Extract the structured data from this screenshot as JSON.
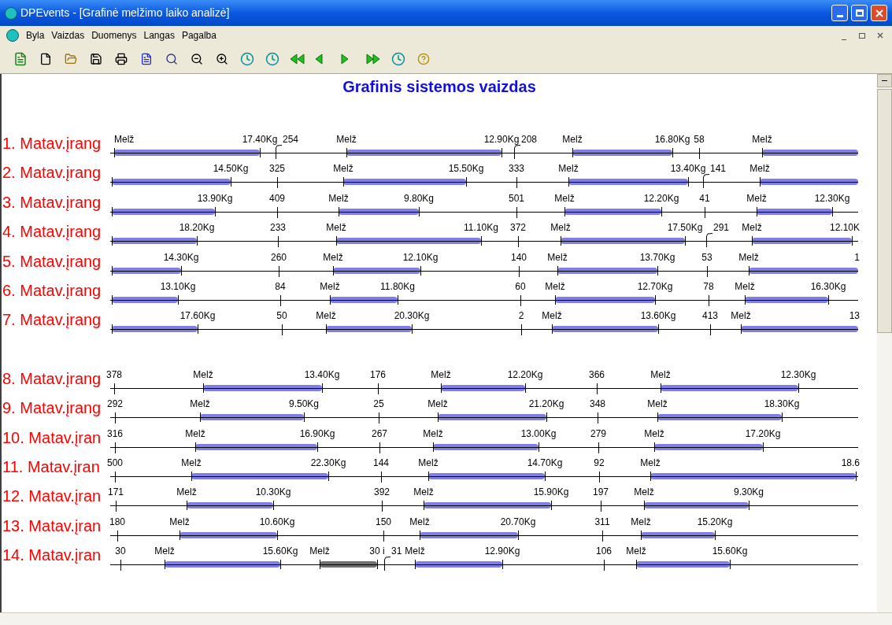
{
  "window": {
    "title": "DPEvents - [Grafinė melžimo laiko analizė]"
  },
  "menu": [
    "Byla",
    "Vaizdas",
    "Duomenys",
    "Langas",
    "Pagalba"
  ],
  "chart": {
    "title": "Grafinis sistemos vaizdas",
    "groups": [
      {
        "rows": [
          {
            "label": "1. Matav.įrang",
            "items": [
              {
                "kind": "milking",
                "start": "Melž",
                "end": "17.40Kg"
              },
              {
                "kind": "callout",
                "text": "254"
              },
              {
                "kind": "milking",
                "start": "Melž",
                "end": "12.90Kg"
              },
              {
                "kind": "callout",
                "text": "208"
              },
              {
                "kind": "milking",
                "start": "Melž",
                "end": "16.80Kg"
              },
              {
                "kind": "tick",
                "text": "58"
              },
              {
                "kind": "milking",
                "start": "Melž"
              }
            ]
          },
          {
            "label": "2. Matav.įrang",
            "items": [
              {
                "kind": "milking",
                "end": "14.50Kg"
              },
              {
                "kind": "tick",
                "text": "325"
              },
              {
                "kind": "milking",
                "start": "Melž",
                "end": "15.50Kg"
              },
              {
                "kind": "tick",
                "text": "333"
              },
              {
                "kind": "milking",
                "start": "Melž",
                "end": "13.40Kg"
              },
              {
                "kind": "callout",
                "text": "141"
              },
              {
                "kind": "milking",
                "start": "Melž"
              }
            ]
          },
          {
            "label": "3. Matav.įrang",
            "items": [
              {
                "kind": "milking",
                "end": "13.90Kg"
              },
              {
                "kind": "tick",
                "text": "409"
              },
              {
                "kind": "milking",
                "start": "Melž",
                "end": "9.80Kg"
              },
              {
                "kind": "tick",
                "text": "501"
              },
              {
                "kind": "milking",
                "start": "Melž",
                "end": "12.20Kg"
              },
              {
                "kind": "tick",
                "text": "41"
              },
              {
                "kind": "milking",
                "start": "Melž",
                "end": "12.30Kg"
              }
            ]
          },
          {
            "label": "4. Matav.įrang",
            "items": [
              {
                "kind": "milking",
                "end": "18.20Kg"
              },
              {
                "kind": "tick",
                "text": "233"
              },
              {
                "kind": "milking",
                "start": "Melž",
                "end": "11.10Kg"
              },
              {
                "kind": "tick",
                "text": "372"
              },
              {
                "kind": "milking",
                "start": "Melž",
                "end": "17.50Kg"
              },
              {
                "kind": "callout",
                "text": "291"
              },
              {
                "kind": "milking",
                "start": "Melž",
                "end": "12.10K"
              }
            ]
          },
          {
            "label": "5. Matav.įrang",
            "items": [
              {
                "kind": "milking",
                "end": "14.30Kg"
              },
              {
                "kind": "tick",
                "text": "260"
              },
              {
                "kind": "milking",
                "start": "Melž",
                "end": "12.10Kg"
              },
              {
                "kind": "tick",
                "text": "140"
              },
              {
                "kind": "milking",
                "start": "Melž",
                "end": "13.70Kg"
              },
              {
                "kind": "tick",
                "text": "53"
              },
              {
                "kind": "milking",
                "start": "Melž",
                "end": "1"
              }
            ]
          },
          {
            "label": "6. Matav.įrang",
            "items": [
              {
                "kind": "milking",
                "end": "13.10Kg"
              },
              {
                "kind": "tick",
                "text": "84"
              },
              {
                "kind": "milking",
                "start": "Melž",
                "end": "11.80Kg"
              },
              {
                "kind": "tick",
                "text": "60"
              },
              {
                "kind": "milking",
                "start": "Melž",
                "end": "12.70Kg"
              },
              {
                "kind": "tick",
                "text": "78"
              },
              {
                "kind": "milking",
                "start": "Melž",
                "end": "16.30Kg"
              }
            ]
          },
          {
            "label": "7. Matav.įrang",
            "items": [
              {
                "kind": "milking",
                "end": "17.60Kg"
              },
              {
                "kind": "tick",
                "text": "50"
              },
              {
                "kind": "milking",
                "start": "Melž",
                "end": "20.30Kg"
              },
              {
                "kind": "tick",
                "text": "2"
              },
              {
                "kind": "milking",
                "start": "Melž",
                "end": "13.60Kg"
              },
              {
                "kind": "tick",
                "text": "413"
              },
              {
                "kind": "milking",
                "start": "Melž",
                "end": "13"
              }
            ]
          }
        ]
      },
      {
        "rows": [
          {
            "label": "8. Matav.įrang",
            "items": [
              {
                "kind": "tick",
                "text": "378"
              },
              {
                "kind": "milking",
                "start": "Melž",
                "end": "13.40Kg"
              },
              {
                "kind": "tick",
                "text": "176"
              },
              {
                "kind": "milking",
                "start": "Melž",
                "end": "12.20Kg"
              },
              {
                "kind": "tick",
                "text": "366"
              },
              {
                "kind": "milking",
                "start": "Melž",
                "end": "12.30Kg"
              }
            ]
          },
          {
            "label": "9. Matav.įrang",
            "items": [
              {
                "kind": "tick",
                "text": "292"
              },
              {
                "kind": "milking",
                "start": "Melž",
                "end": "9.50Kg"
              },
              {
                "kind": "tick",
                "text": "25"
              },
              {
                "kind": "milking",
                "start": "Melž",
                "end": "21.20Kg"
              },
              {
                "kind": "tick",
                "text": "348"
              },
              {
                "kind": "milking",
                "start": "Melž",
                "end": "18.30Kg"
              }
            ]
          },
          {
            "label": "10. Matav.įran",
            "items": [
              {
                "kind": "tick",
                "text": "316"
              },
              {
                "kind": "milking",
                "start": "Melž",
                "end": "16.90Kg"
              },
              {
                "kind": "tick",
                "text": "267"
              },
              {
                "kind": "milking",
                "start": "Melž",
                "end": "13.00Kg"
              },
              {
                "kind": "tick",
                "text": "279"
              },
              {
                "kind": "milking",
                "start": "Melž",
                "end": "17.20Kg"
              }
            ]
          },
          {
            "label": "11. Matav.įran",
            "items": [
              {
                "kind": "tick",
                "text": "500"
              },
              {
                "kind": "milking",
                "start": "Melž",
                "end": "22.30Kg"
              },
              {
                "kind": "tick",
                "text": "144"
              },
              {
                "kind": "milking",
                "start": "Melž",
                "end": "14.70Kg"
              },
              {
                "kind": "tick",
                "text": "92"
              },
              {
                "kind": "milking",
                "start": "Melž",
                "end": "18.6"
              }
            ]
          },
          {
            "label": "12. Matav.įran",
            "items": [
              {
                "kind": "tick",
                "text": "171"
              },
              {
                "kind": "milking",
                "start": "Melž",
                "end": "10.30Kg"
              },
              {
                "kind": "tick",
                "text": "392"
              },
              {
                "kind": "milking",
                "start": "Melž",
                "end": "15.90Kg"
              },
              {
                "kind": "tick",
                "text": "197"
              },
              {
                "kind": "milking",
                "start": "Melž",
                "end": "9.30Kg"
              }
            ]
          },
          {
            "label": "13. Matav.įran",
            "items": [
              {
                "kind": "tick",
                "text": "180"
              },
              {
                "kind": "milking",
                "start": "Melž",
                "end": "10.60Kg"
              },
              {
                "kind": "tick",
                "text": "150"
              },
              {
                "kind": "milking",
                "start": "Melž",
                "end": "20.70Kg"
              },
              {
                "kind": "tick",
                "text": "311"
              },
              {
                "kind": "milking",
                "start": "Melž",
                "end": "15.20Kg"
              }
            ]
          },
          {
            "label": "14. Matav.įran",
            "items": [
              {
                "kind": "tick",
                "text": "30"
              },
              {
                "kind": "milking",
                "start": "Melž",
                "end": "15.60Kg"
              },
              {
                "kind": "idle",
                "start": "Melž",
                "end": "30 i"
              },
              {
                "kind": "callout",
                "text": "31"
              },
              {
                "kind": "milking",
                "start": "Melž",
                "end": "12.90Kg"
              },
              {
                "kind": "tick",
                "text": "106"
              },
              {
                "kind": "milking",
                "start": "Melž",
                "end": "15.60Kg"
              }
            ]
          }
        ]
      }
    ]
  }
}
